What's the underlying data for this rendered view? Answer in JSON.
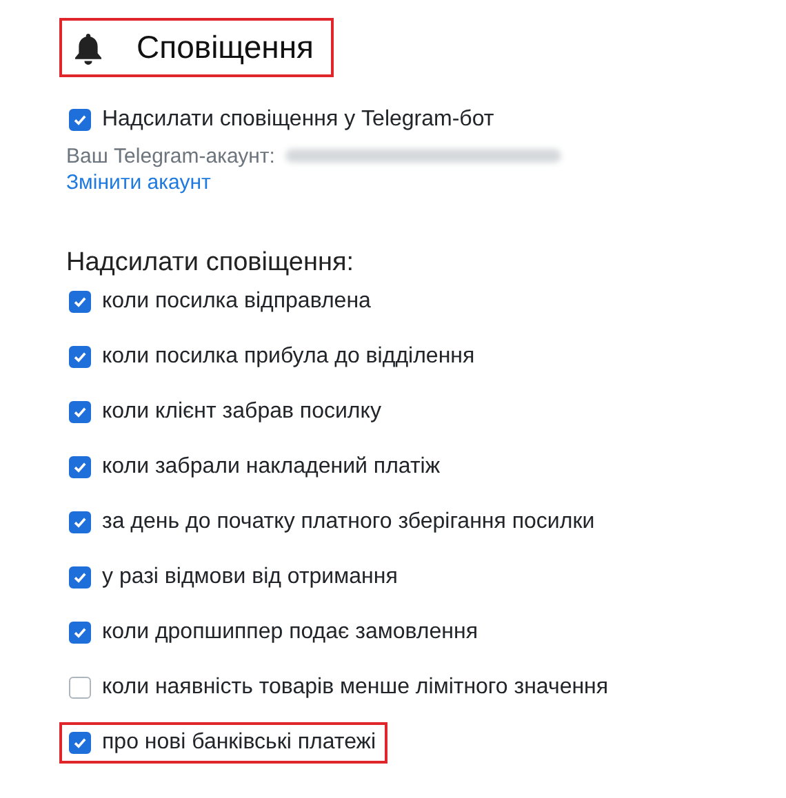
{
  "header": {
    "title": "Сповіщення",
    "highlighted": true
  },
  "telegram": {
    "label": "Надсилати сповіщення у Telegram-бот",
    "checked": true,
    "account_label": "Ваш Telegram-акаунт:",
    "change_link": "Змінити акаунт"
  },
  "notify_heading": "Надсилати сповіщення:",
  "options": [
    {
      "label": "коли посилка відправлена",
      "checked": true,
      "highlighted": false
    },
    {
      "label": "коли посилка прибула до відділення",
      "checked": true,
      "highlighted": false
    },
    {
      "label": "коли клієнт забрав посилку",
      "checked": true,
      "highlighted": false
    },
    {
      "label": "коли забрали накладений платіж",
      "checked": true,
      "highlighted": false
    },
    {
      "label": "за день до початку платного зберігання посилки",
      "checked": true,
      "highlighted": false
    },
    {
      "label": "у разі відмови від отримання",
      "checked": true,
      "highlighted": false
    },
    {
      "label": "коли дропшиппер подає замовлення",
      "checked": true,
      "highlighted": false
    },
    {
      "label": "коли наявність товарів менше лімітного значення",
      "checked": false,
      "highlighted": false
    },
    {
      "label": "про нові банківські платежі",
      "checked": true,
      "highlighted": true
    }
  ]
}
